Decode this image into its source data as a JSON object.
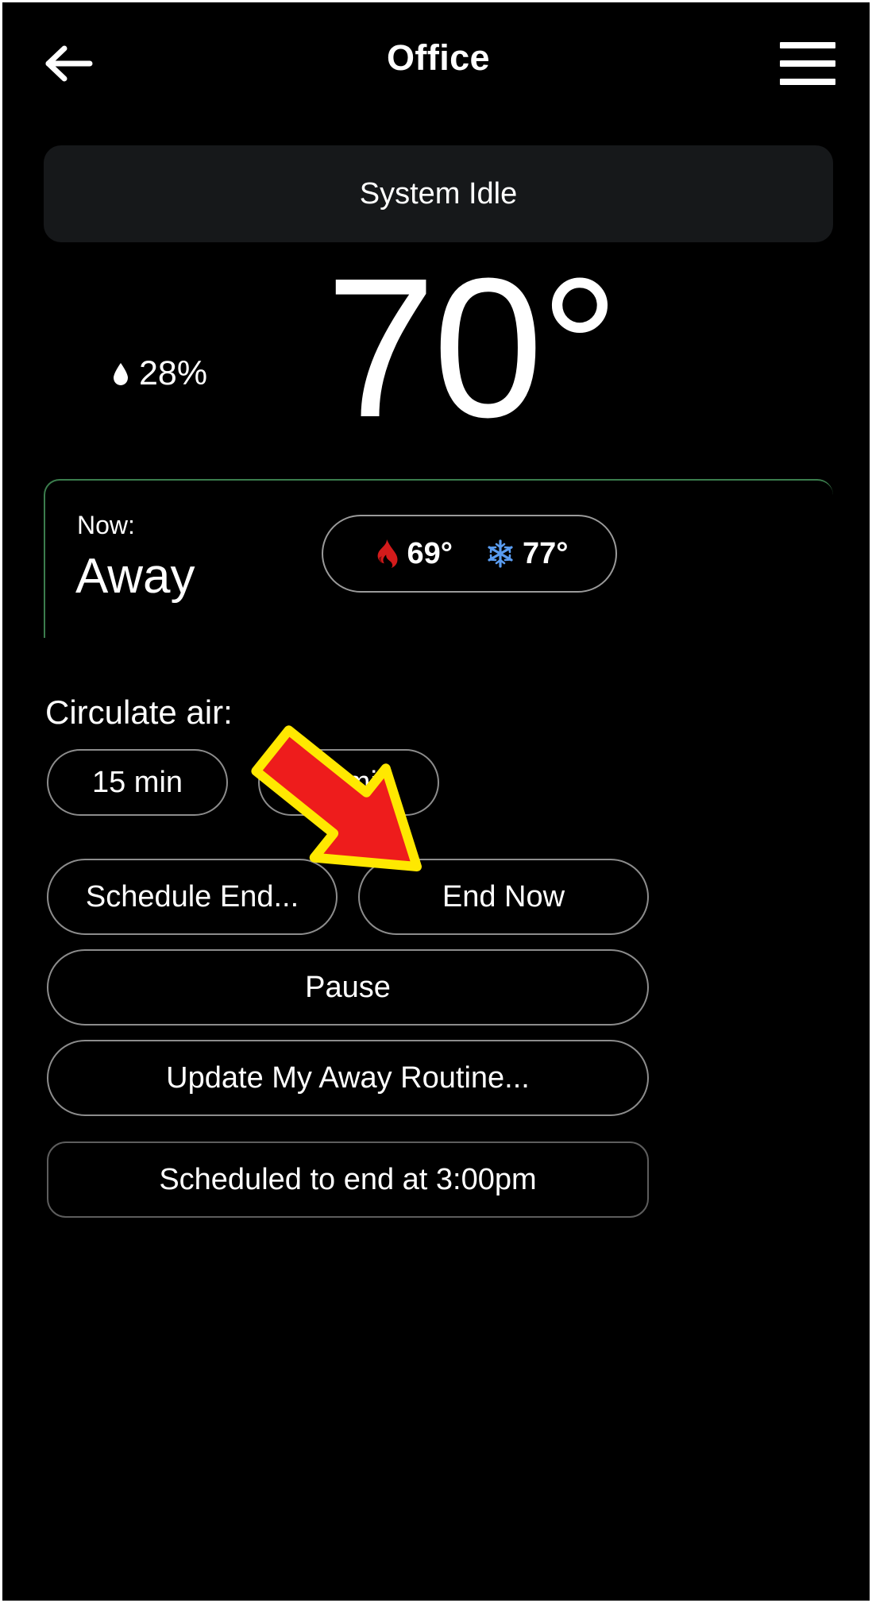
{
  "header": {
    "title": "Office",
    "back_icon": "arrow-left-icon",
    "menu_icon": "hamburger-menu-icon"
  },
  "status": {
    "system_state": "System Idle"
  },
  "climate": {
    "current_temperature": "70°",
    "humidity": "28%",
    "humidity_icon": "water-droplet-icon"
  },
  "mode_card": {
    "now_label": "Now:",
    "mode_name": "Away",
    "border_color": "#3b7d4d",
    "setpoints": [
      {
        "icon": "flame-icon",
        "value": "69°",
        "color": "#d41b1b"
      },
      {
        "icon": "snowflake-icon",
        "value": "77°",
        "color": "#5a9cf0"
      }
    ]
  },
  "circulate_air": {
    "label": "Circulate air:",
    "options": [
      {
        "label": "15 min"
      },
      {
        "label": "30 min"
      }
    ]
  },
  "actions": [
    {
      "label": "Schedule End..."
    },
    {
      "label": "End Now"
    },
    {
      "label": "Pause"
    },
    {
      "label": "Update My Away Routine..."
    }
  ],
  "scheduled": {
    "label": "Scheduled to end at 3:00pm"
  },
  "annotation": {
    "type": "arrow",
    "fill_color": "#ee1c1c",
    "outline_color": "#ffe800",
    "points_to": "End Now"
  }
}
